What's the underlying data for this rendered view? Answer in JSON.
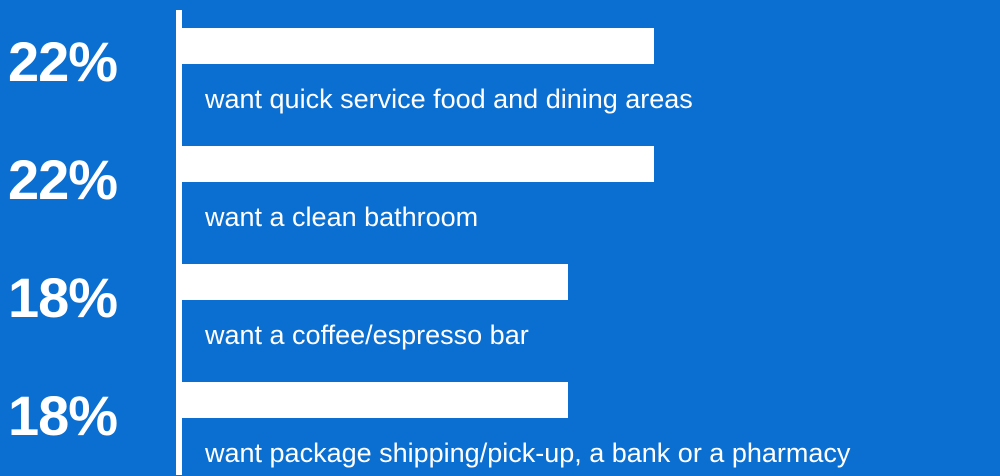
{
  "chart_data": {
    "type": "bar",
    "orientation": "horizontal",
    "categories": [
      "want quick service food and dining areas",
      "want a clean bathroom",
      "want a coffee/espresso bar",
      "want package shipping/pick-up, a bank or a pharmacy"
    ],
    "values": [
      22,
      22,
      18,
      18
    ],
    "value_labels": [
      "22%",
      "22%",
      "18%",
      "18%"
    ],
    "unit": "%",
    "xlim": [
      0,
      22
    ],
    "grid": false,
    "colors": {
      "background": "#0a6fd1",
      "bar": "#ffffff",
      "text": "#ffffff"
    }
  }
}
